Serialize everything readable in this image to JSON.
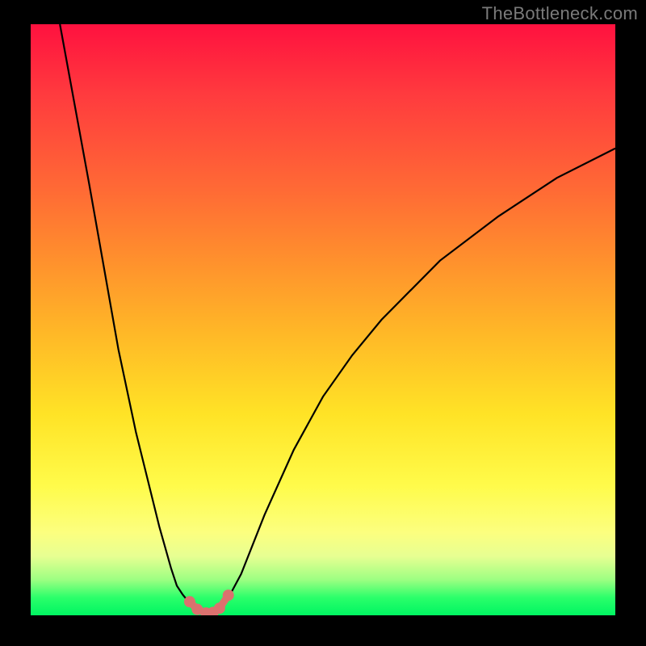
{
  "watermark": "TheBottleneck.com",
  "chart_data": {
    "type": "line",
    "title": "",
    "xlabel": "",
    "ylabel": "",
    "xlim": [
      0,
      100
    ],
    "ylim": [
      0,
      100
    ],
    "legend": false,
    "grid": false,
    "background_gradient": {
      "direction": "vertical",
      "stops": [
        {
          "pos": 0.0,
          "color": "#ff113f"
        },
        {
          "pos": 0.5,
          "color": "#ffb727"
        },
        {
          "pos": 0.8,
          "color": "#fffb4a"
        },
        {
          "pos": 1.0,
          "color": "#00f562"
        }
      ]
    },
    "series": [
      {
        "name": "left-branch",
        "x": [
          5,
          10,
          15,
          18,
          20,
          22,
          24,
          25,
          26,
          27,
          28,
          29
        ],
        "y": [
          100,
          73,
          45,
          31,
          23,
          15,
          8,
          5,
          3.5,
          2.3,
          1.3,
          0.6
        ]
      },
      {
        "name": "right-branch",
        "x": [
          32,
          33,
          34,
          36,
          40,
          45,
          50,
          55,
          60,
          70,
          80,
          90,
          100
        ],
        "y": [
          0.6,
          1.6,
          3.3,
          7,
          17,
          28,
          37,
          44,
          50,
          60,
          67.5,
          74,
          79
        ]
      }
    ],
    "markers": {
      "name": "cluster-points",
      "color": "#db716e",
      "points": [
        {
          "x": 27.2,
          "y": 2.3
        },
        {
          "x": 28.5,
          "y": 1.0
        },
        {
          "x": 30.0,
          "y": 0.4
        },
        {
          "x": 31.2,
          "y": 0.5
        },
        {
          "x": 32.3,
          "y": 1.2
        },
        {
          "x": 33.8,
          "y": 3.4
        }
      ]
    }
  }
}
